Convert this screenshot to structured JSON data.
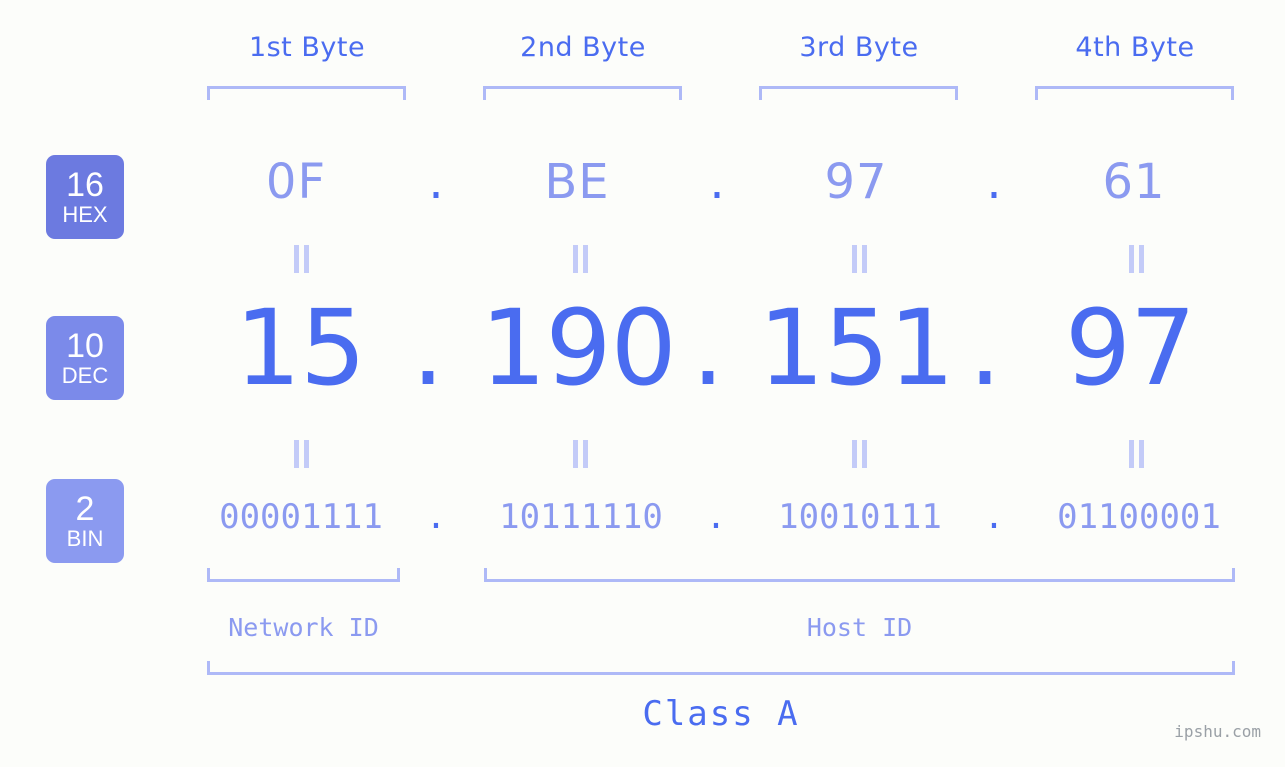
{
  "diagram": {
    "ip_address": "15.190.151.97",
    "ip_class": "Class A",
    "watermark": "ipshu.com"
  },
  "header": {
    "byte_labels": [
      "1st Byte",
      "2nd Byte",
      "3rd Byte",
      "4th Byte"
    ]
  },
  "badges": [
    {
      "num": "16",
      "abbr": "HEX",
      "color": "#6c7ae0"
    },
    {
      "num": "10",
      "abbr": "DEC",
      "color": "#7b8aea"
    },
    {
      "num": "2",
      "abbr": "BIN",
      "color": "#8b9af0"
    }
  ],
  "rows": {
    "hex": {
      "octets": [
        "0F",
        "BE",
        "97",
        "61"
      ],
      "separator": "."
    },
    "dec": {
      "octets": [
        "15",
        "190",
        "151",
        "97"
      ],
      "separator": "."
    },
    "bin": {
      "octets": [
        "00001111",
        "10111110",
        "10010111",
        "01100001"
      ],
      "separator": "."
    }
  },
  "regions": {
    "network_id": "Network ID",
    "host_id": "Host ID"
  },
  "colors": {
    "background": "#fcfdfa",
    "accent_strong": "#4a6cf0",
    "accent_light": "#8b9af0",
    "bracket": "#aeb9f7",
    "eq_mark": "#c3cbf8",
    "watermark": "#9aa0a6"
  }
}
